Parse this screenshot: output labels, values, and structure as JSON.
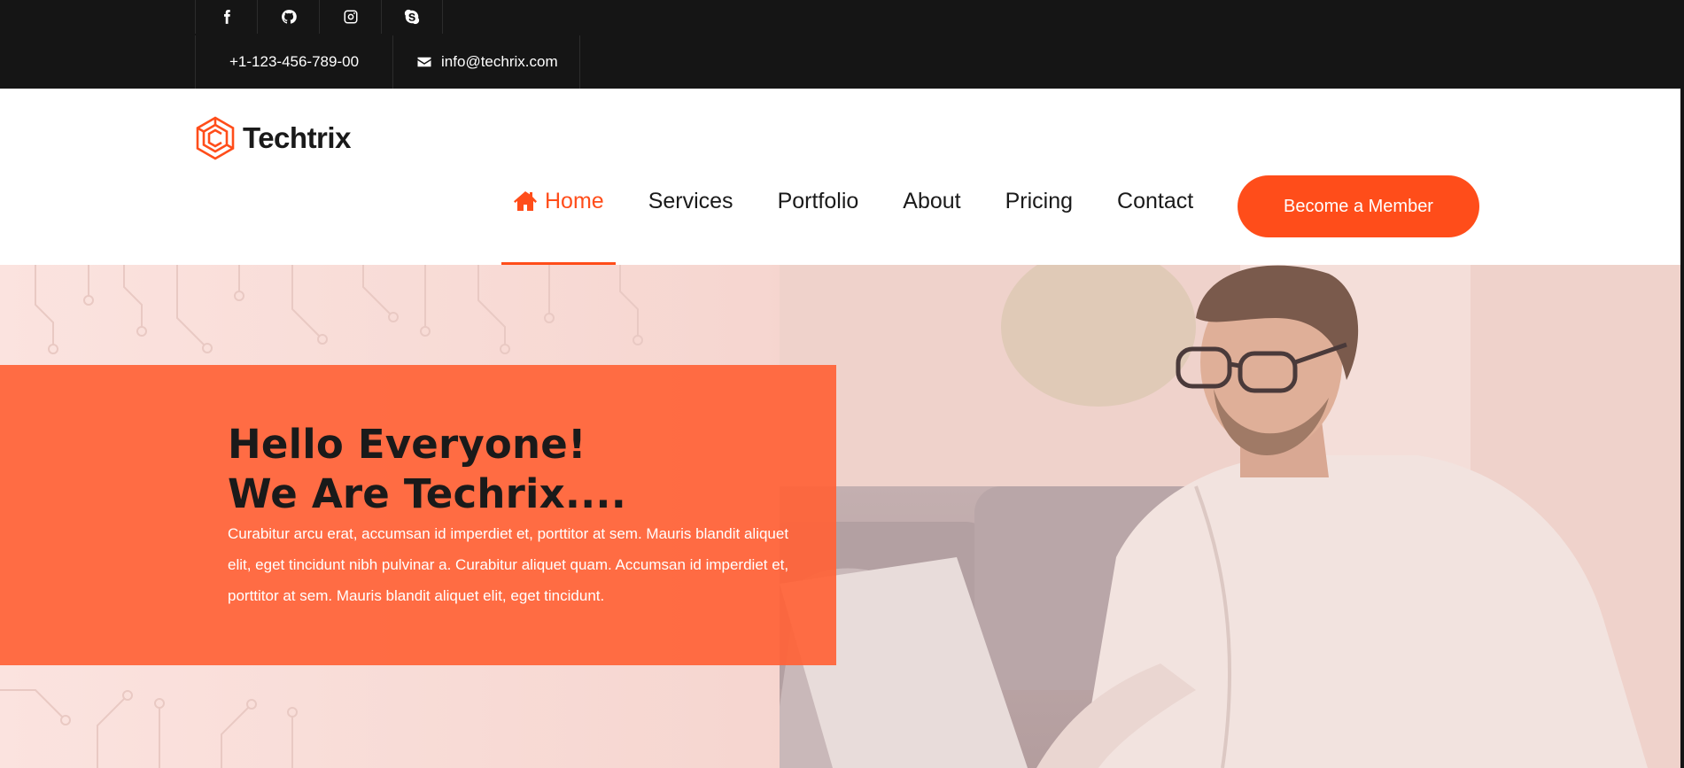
{
  "topbar": {
    "social": [
      {
        "icon": "facebook-icon"
      },
      {
        "icon": "github-icon"
      },
      {
        "icon": "instagram-icon"
      },
      {
        "icon": "skype-icon"
      }
    ],
    "phone": "+1-123-456-789-00",
    "email": "info@techrix.com"
  },
  "brand": {
    "name": "Techtrix",
    "logo_icon": "hexagon-logo-icon"
  },
  "nav": {
    "home": "Home",
    "services": "Services",
    "portfolio": "Portfolio",
    "about": "About",
    "pricing": "Pricing",
    "contact": "Contact",
    "active": "Home"
  },
  "cta": {
    "label": "Become a Member"
  },
  "hero": {
    "title_line1": "Hello Everyone!",
    "title_line2": "We Are Techrix....",
    "text": "Curabitur arcu erat, accumsan id imperdiet et, porttitor at sem. Mauris blandit aliquet elit, eget tincidunt nibh pulvinar a. Curabitur aliquet quam. Accumsan id imperdiet et, porttitor at sem. Mauris blandit aliquet elit, eget tincidunt."
  },
  "colors": {
    "accent": "#ff4d1a",
    "topbar": "#151515",
    "panel": "#ff6338"
  }
}
